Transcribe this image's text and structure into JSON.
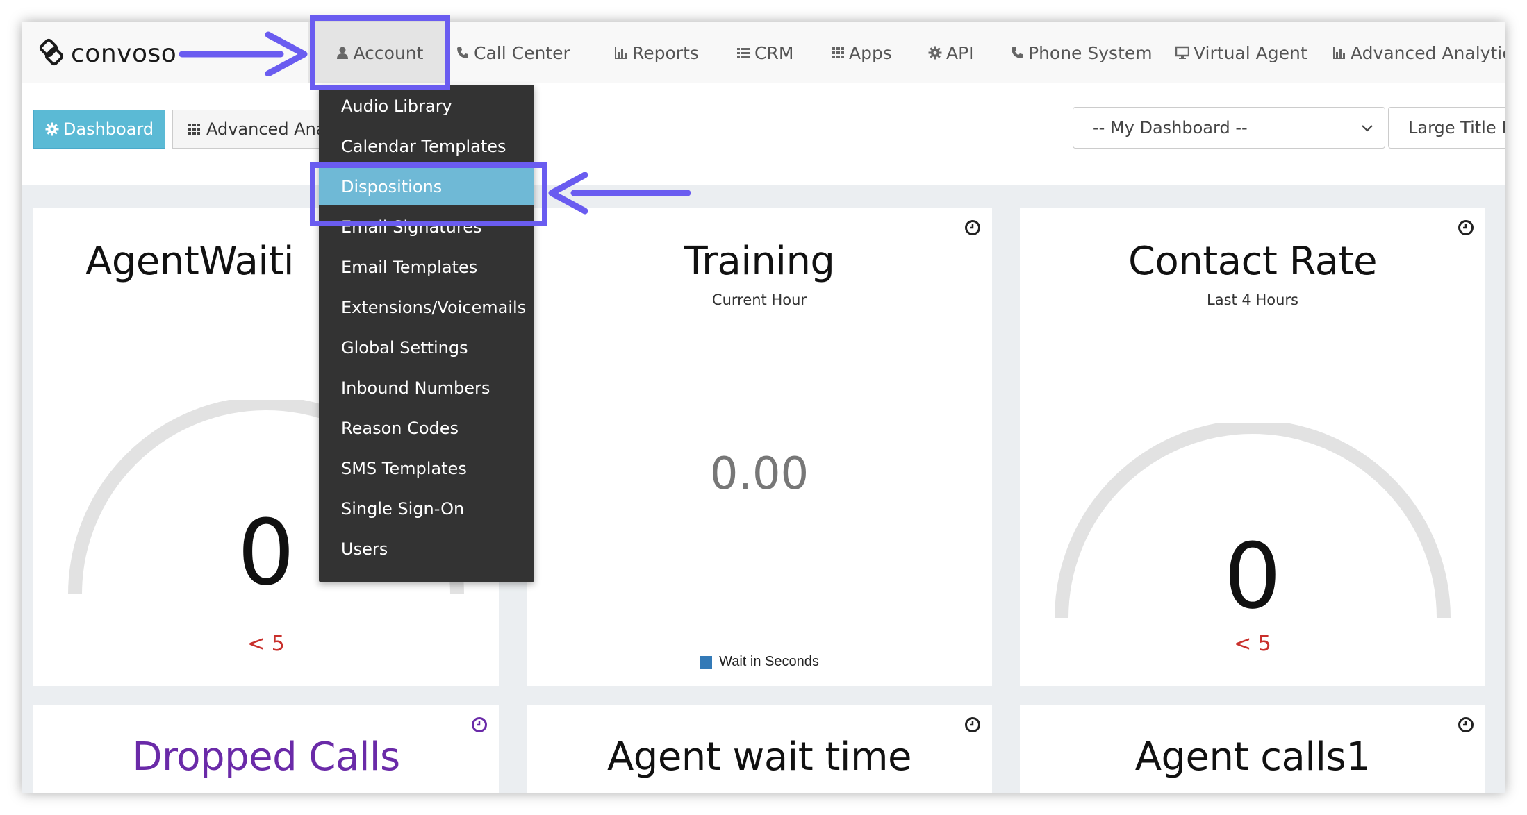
{
  "brand": {
    "name": "convoso"
  },
  "nav": {
    "items": [
      {
        "label": "Account",
        "icon": "user-icon"
      },
      {
        "label": "Call Center",
        "icon": "phone-icon"
      },
      {
        "label": "Reports",
        "icon": "bar-chart-icon"
      },
      {
        "label": "CRM",
        "icon": "list-icon"
      },
      {
        "label": "Apps",
        "icon": "grid-icon"
      },
      {
        "label": "API",
        "icon": "gear-icon"
      },
      {
        "label": "Phone System",
        "icon": "phone-icon"
      },
      {
        "label": "Virtual Agent",
        "icon": "monitor-icon"
      },
      {
        "label": "Advanced Analytics",
        "icon": "bar-chart-icon"
      }
    ]
  },
  "toolbar": {
    "dashboard_label": "Dashboard",
    "advanced_label": "Advanced Anal",
    "dashboard_select": "-- My Dashboard --",
    "font_select": "Large Title Fo"
  },
  "account_menu": {
    "items": [
      "Audio Library",
      "Calendar Templates",
      "Dispositions",
      "Email Signatures",
      "Email Templates",
      "Extensions/Voicemails",
      "Global Settings",
      "Inbound Numbers",
      "Reason Codes",
      "SMS Templates",
      "Single Sign-On",
      "Users"
    ],
    "highlighted": "Dispositions"
  },
  "widgets": {
    "agent_waiting": {
      "title": "AgentWaiti",
      "value": "0",
      "threshold": "< 5"
    },
    "training": {
      "title": "Training",
      "subtitle": "Current Hour",
      "value": "0.00",
      "legend": "Wait in Seconds"
    },
    "contact_rate": {
      "title": "Contact Rate",
      "subtitle": "Last 4 Hours",
      "value": "0",
      "threshold": "< 5"
    },
    "dropped_calls": {
      "title": "Dropped Calls"
    },
    "agent_wait_time": {
      "title": "Agent wait time"
    },
    "agent_calls": {
      "title": "Agent calls1"
    }
  },
  "colors": {
    "annotation": "#6a5cf0",
    "dashboard_button": "#5bbad5",
    "menu_bg": "#333333",
    "menu_highlight": "#6fb9d6",
    "threshold": "#c9302c",
    "dropped_calls_title": "#6a2aa8",
    "legend_swatch": "#337ab7"
  }
}
